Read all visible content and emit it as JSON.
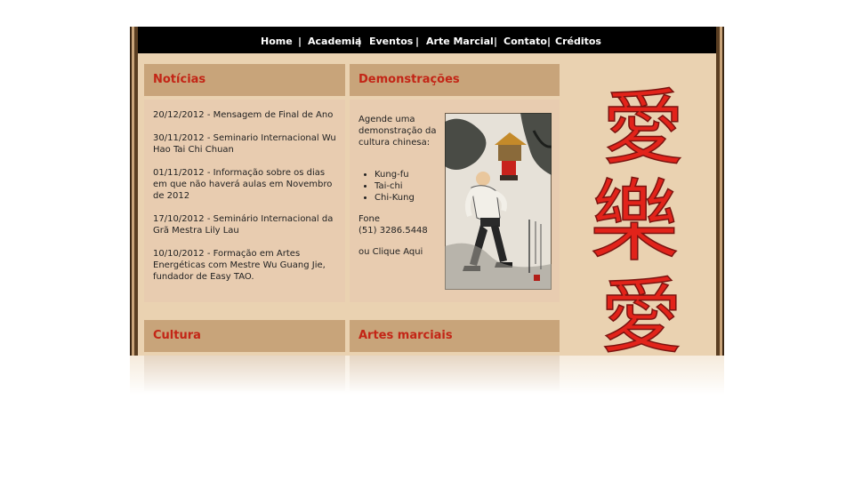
{
  "nav": {
    "items": [
      "Home",
      "Academia",
      "Eventos",
      "Arte Marcial",
      "Contato",
      "Créditos"
    ],
    "separator": "|"
  },
  "noticias": {
    "title": "Notícias",
    "items": [
      "20/12/2012 - Mensagem de Final de Ano",
      "30/11/2012 - Seminario Internacional Wu Hao Tai Chi Chuan",
      "01/11/2012 - Informação sobre os dias em que não haverá aulas em Novembro de 2012",
      "17/10/2012 - Seminário Internacional da Grã Mestra Lily Lau",
      "10/10/2012 - Formação em Artes Energéticas com Mestre Wu Guang Jie, fundador de Easy TAO."
    ]
  },
  "demonstracoes": {
    "title": "Demonstrações",
    "intro": "Agende uma demonstração da cultura chinesa:",
    "list": [
      "Kung-fu",
      "Tai-chi",
      "Chi-Kung"
    ],
    "phone_label": "Fone",
    "phone": "(51) 3286.5448",
    "cta": "ou Clique Aqui"
  },
  "cultura": {
    "title": "Cultura"
  },
  "artes_marciais": {
    "title": "Artes marciais"
  },
  "decor": {
    "characters": [
      "愛",
      "樂",
      "愛"
    ],
    "glyph_color": "#e2231a",
    "accent_color": "#c32516",
    "header_bg": "#c8a47a",
    "panel_bg": "#e8ccb0",
    "page_bg": "#ead2b1",
    "painting_icon": "kungfu-painting-icon"
  }
}
